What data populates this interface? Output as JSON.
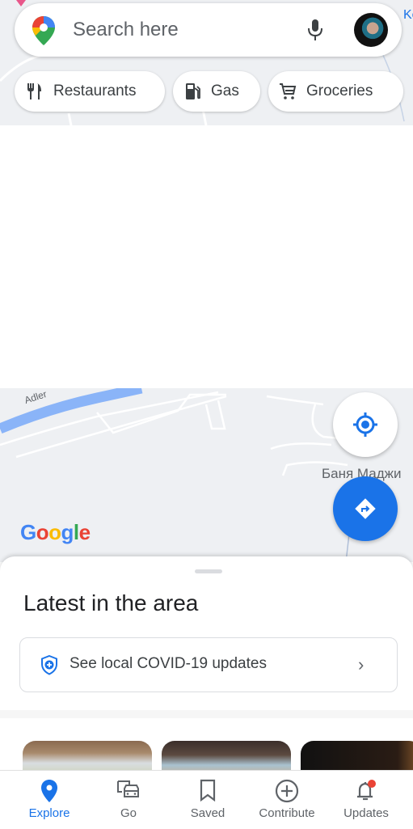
{
  "search": {
    "placeholder": "Search here"
  },
  "map": {
    "edge_label": "Ke",
    "river_label": "Adler",
    "place_label": "Баня Маджи",
    "logo": "Google"
  },
  "chips": [
    {
      "label": "Restaurants",
      "icon": "restaurant-icon"
    },
    {
      "label": "Gas",
      "icon": "gas-station-icon"
    },
    {
      "label": "Groceries",
      "icon": "cart-icon"
    }
  ],
  "sheet": {
    "title": "Latest in the area",
    "covid_label": "See local COVID-19 updates",
    "chevron": "›"
  },
  "nav": [
    {
      "label": "Explore",
      "icon": "explore-pin-icon",
      "active": true
    },
    {
      "label": "Go",
      "icon": "commute-icon"
    },
    {
      "label": "Saved",
      "icon": "bookmark-icon"
    },
    {
      "label": "Contribute",
      "icon": "add-circle-icon"
    },
    {
      "label": "Updates",
      "icon": "bell-icon",
      "badge": true
    }
  ],
  "colors": {
    "accent": "#1a73e8",
    "badge": "#ea4335",
    "river": "#8ab4f8"
  }
}
